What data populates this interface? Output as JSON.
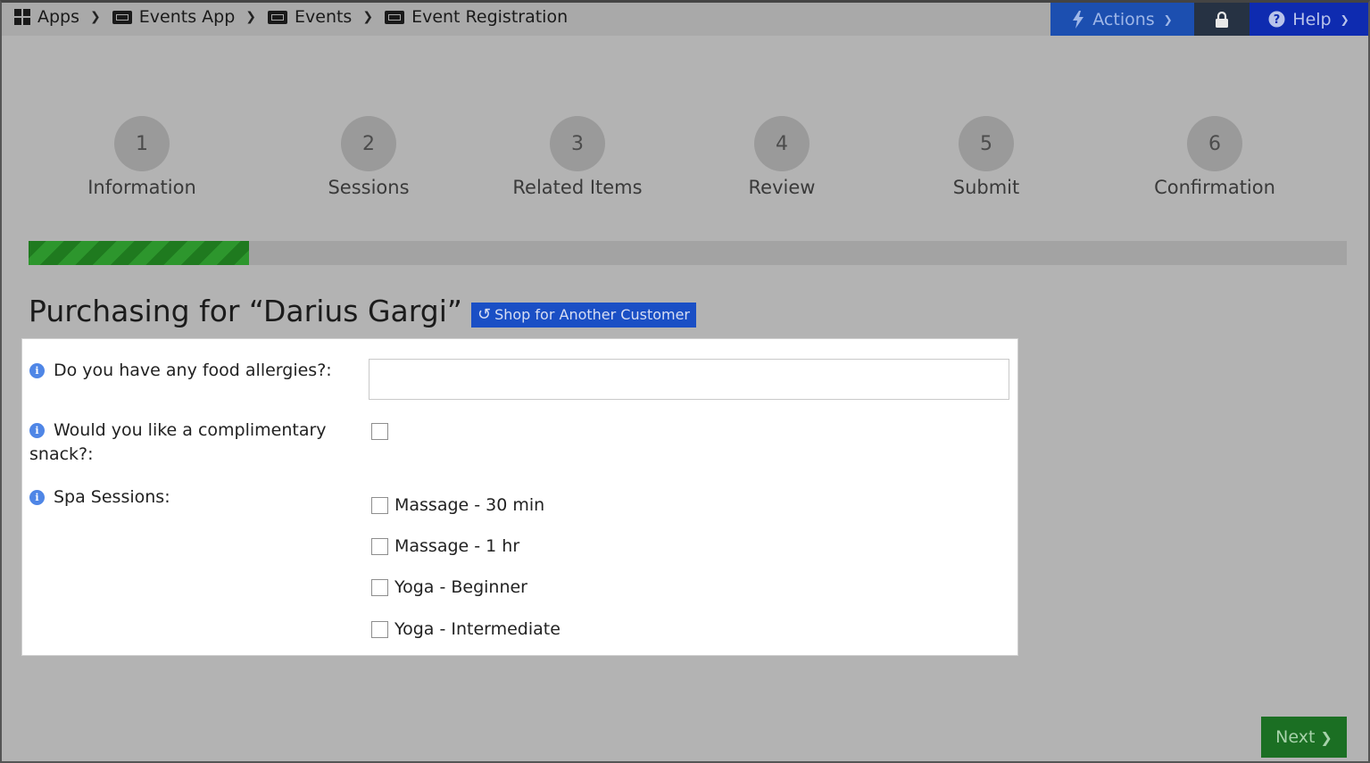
{
  "breadcrumb": [
    {
      "label": "Apps",
      "icon": "apps-grid-icon"
    },
    {
      "label": "Events App",
      "icon": "ticket-icon"
    },
    {
      "label": "Events",
      "icon": "ticket-icon"
    },
    {
      "label": "Event Registration",
      "icon": "ticket-icon"
    }
  ],
  "toolbar": {
    "actions_label": "Actions",
    "help_label": "Help"
  },
  "steps": [
    {
      "number": "1",
      "label": "Information"
    },
    {
      "number": "2",
      "label": "Sessions"
    },
    {
      "number": "3",
      "label": "Related Items"
    },
    {
      "number": "4",
      "label": "Review"
    },
    {
      "number": "5",
      "label": "Submit"
    },
    {
      "number": "6",
      "label": "Confirmation"
    }
  ],
  "progress_fraction": 0.167,
  "colors": {
    "progress": "#2d962d",
    "accent": "#1a4fc5",
    "next": "#1b6f23"
  },
  "purchasing": {
    "heading": "Purchasing for “Darius Gargi”",
    "shop_another": "Shop for Another Customer"
  },
  "form": {
    "allergies_label": "Do you have any food allergies?:",
    "allergies_value": "",
    "snack_label": "Would you like a complimentary snack?:",
    "spa_label": "Spa Sessions:",
    "spa_options": [
      "Massage - 30 min",
      "Massage - 1 hr",
      "Yoga - Beginner",
      "Yoga - Intermediate"
    ]
  },
  "next_label": "Next"
}
